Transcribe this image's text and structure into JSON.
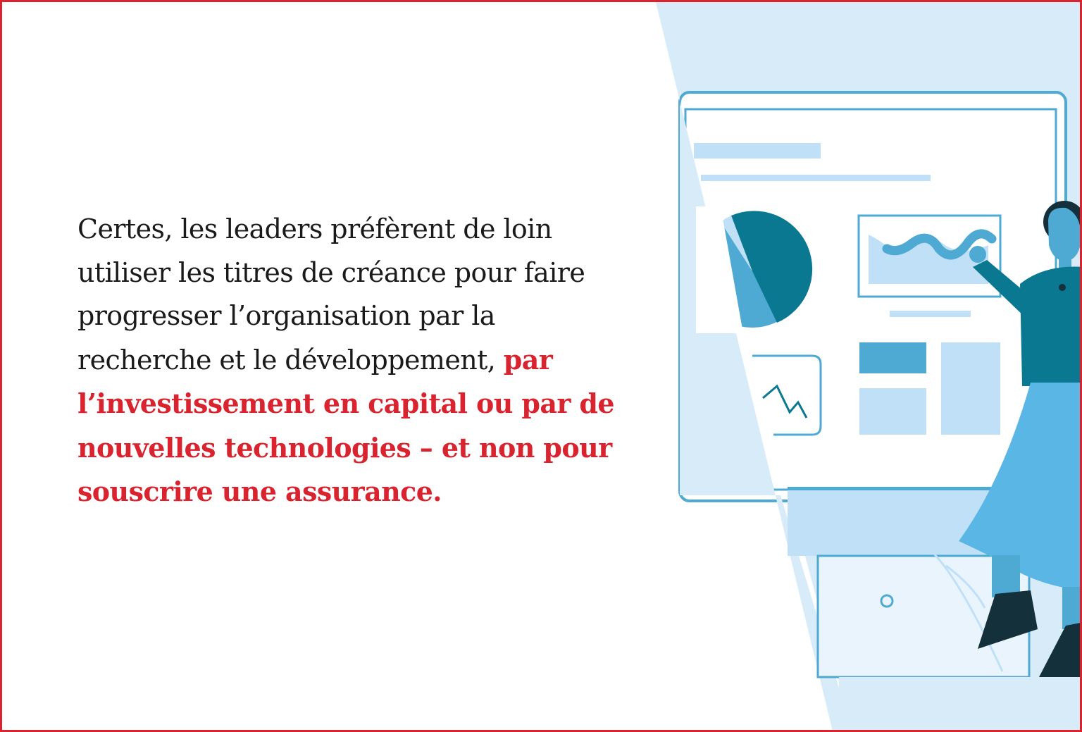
{
  "quote": {
    "plain": "Certes, les leaders préfèrent de loin utiliser les titres de créance pour faire progresser l’organisation par la recherche et le développement, ",
    "highlight": "par l’investissement en capital ou par de nouvelles technologies – et non pour souscrire une assurance."
  },
  "colors": {
    "frame_border": "#d9232e",
    "highlight_text": "#d9232e",
    "body_text": "#1a1a1a",
    "panel_light_blue": "#d8ebf9",
    "accent_blue": "#4ea9d3",
    "dark_teal": "#0b7892"
  },
  "illustration": {
    "subject": "woman presenting a dashboard with pie chart, line graph and blocks",
    "icons": [
      "pie-chart-icon",
      "trend-line-icon",
      "area-chart-icon",
      "dashboard-blocks-icon",
      "presenter-figure-icon"
    ]
  }
}
